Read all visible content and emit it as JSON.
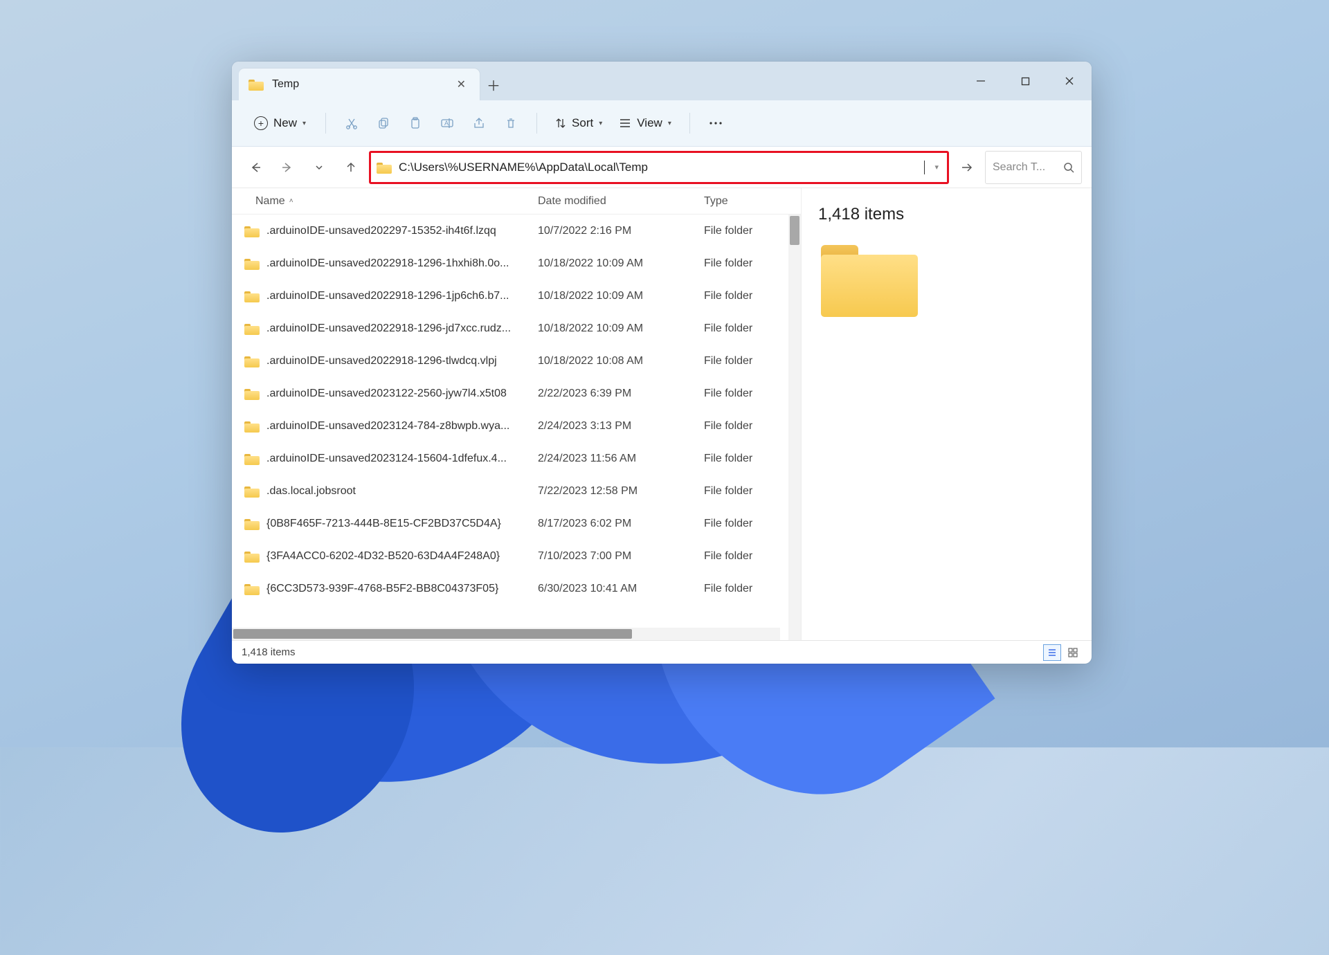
{
  "tab": {
    "title": "Temp"
  },
  "toolbar": {
    "new_label": "New",
    "sort_label": "Sort",
    "view_label": "View"
  },
  "address": {
    "path": "C:\\Users\\%USERNAME%\\AppData\\Local\\Temp"
  },
  "search": {
    "placeholder": "Search T..."
  },
  "columns": {
    "name": "Name",
    "date": "Date modified",
    "type": "Type"
  },
  "rows": [
    {
      "name": ".arduinoIDE-unsaved202297-15352-ih4t6f.lzqq",
      "date": "10/7/2022 2:16 PM",
      "type": "File folder"
    },
    {
      "name": ".arduinoIDE-unsaved2022918-1296-1hxhi8h.0o...",
      "date": "10/18/2022 10:09 AM",
      "type": "File folder"
    },
    {
      "name": ".arduinoIDE-unsaved2022918-1296-1jp6ch6.b7...",
      "date": "10/18/2022 10:09 AM",
      "type": "File folder"
    },
    {
      "name": ".arduinoIDE-unsaved2022918-1296-jd7xcc.rudz...",
      "date": "10/18/2022 10:09 AM",
      "type": "File folder"
    },
    {
      "name": ".arduinoIDE-unsaved2022918-1296-tlwdcq.vlpj",
      "date": "10/18/2022 10:08 AM",
      "type": "File folder"
    },
    {
      "name": ".arduinoIDE-unsaved2023122-2560-jyw7l4.x5t08",
      "date": "2/22/2023 6:39 PM",
      "type": "File folder"
    },
    {
      "name": ".arduinoIDE-unsaved2023124-784-z8bwpb.wya...",
      "date": "2/24/2023 3:13 PM",
      "type": "File folder"
    },
    {
      "name": ".arduinoIDE-unsaved2023124-15604-1dfefux.4...",
      "date": "2/24/2023 11:56 AM",
      "type": "File folder"
    },
    {
      "name": ".das.local.jobsroot",
      "date": "7/22/2023 12:58 PM",
      "type": "File folder"
    },
    {
      "name": "{0B8F465F-7213-444B-8E15-CF2BD37C5D4A}",
      "date": "8/17/2023 6:02 PM",
      "type": "File folder"
    },
    {
      "name": "{3FA4ACC0-6202-4D32-B520-63D4A4F248A0}",
      "date": "7/10/2023 7:00 PM",
      "type": "File folder"
    },
    {
      "name": "{6CC3D573-939F-4768-B5F2-BB8C04373F05}",
      "date": "6/30/2023 10:41 AM",
      "type": "File folder"
    }
  ],
  "detail": {
    "count": "1,418 items"
  },
  "status": {
    "text": "1,418 items"
  }
}
